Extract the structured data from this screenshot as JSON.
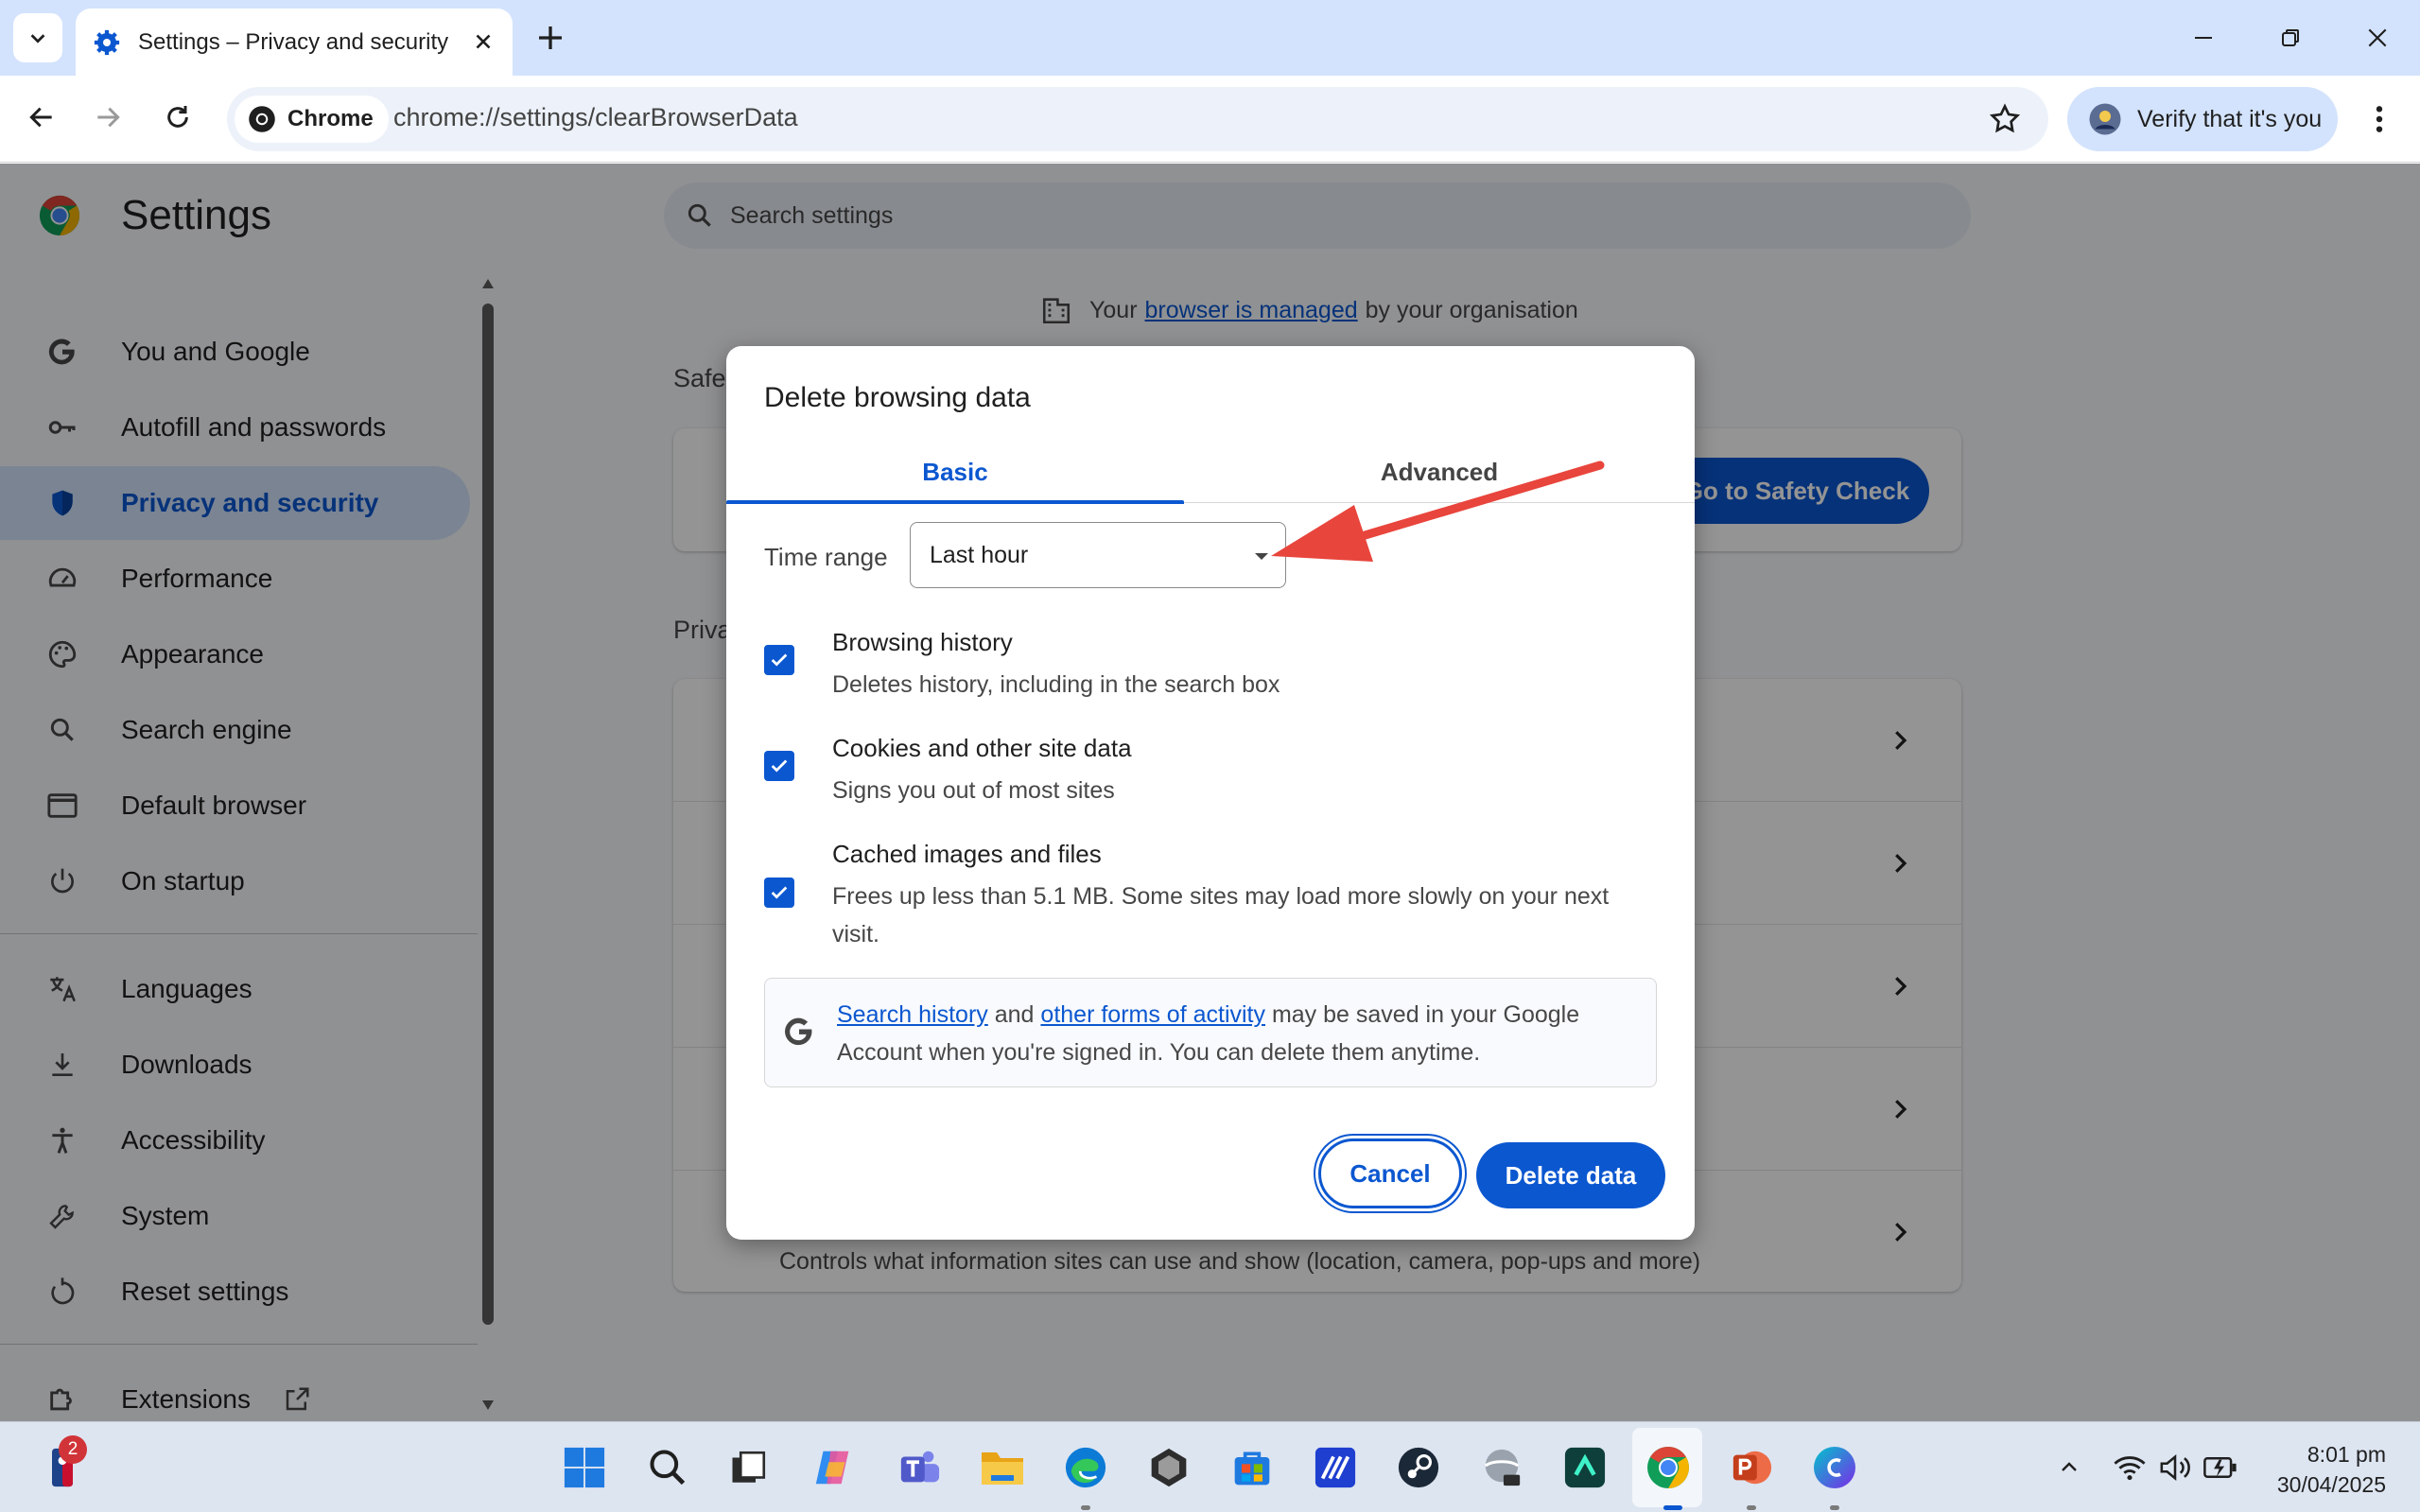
{
  "browser": {
    "tab_title": "Settings – Privacy and security",
    "chip_label": "Chrome",
    "url": "chrome://settings/clearBrowserData",
    "verify_label": "Verify that it's you"
  },
  "settings": {
    "title": "Settings",
    "search_placeholder": "Search settings",
    "managed_prefix": "Your",
    "managed_link": "browser is managed",
    "managed_suffix": "by your organisation",
    "section_safety": "Safe",
    "section_privacy": "Priva",
    "safety_button": "Go to Safety Check",
    "row_last_sub": "Controls what information sites can use and show (location, camera, pop-ups and more)",
    "nav": [
      {
        "label": "You and Google",
        "icon": "google-g-icon"
      },
      {
        "label": "Autofill and passwords",
        "icon": "key-icon"
      },
      {
        "label": "Privacy and security",
        "icon": "shield-icon",
        "active": true
      },
      {
        "label": "Performance",
        "icon": "speedometer-icon"
      },
      {
        "label": "Appearance",
        "icon": "palette-icon"
      },
      {
        "label": "Search engine",
        "icon": "search-icon"
      },
      {
        "label": "Default browser",
        "icon": "browser-window-icon"
      },
      {
        "label": "On startup",
        "icon": "power-icon"
      },
      {
        "label": "Languages",
        "icon": "translate-icon"
      },
      {
        "label": "Downloads",
        "icon": "download-icon"
      },
      {
        "label": "Accessibility",
        "icon": "accessibility-icon"
      },
      {
        "label": "System",
        "icon": "wrench-icon"
      },
      {
        "label": "Reset settings",
        "icon": "reset-icon"
      },
      {
        "label": "Extensions",
        "icon": "puzzle-icon"
      }
    ]
  },
  "dialog": {
    "title": "Delete browsing data",
    "tab_basic": "Basic",
    "tab_advanced": "Advanced",
    "time_range_label": "Time range",
    "time_range_value": "Last hour",
    "options": [
      {
        "title": "Browsing history",
        "desc": "Deletes history, including in the search box",
        "checked": true
      },
      {
        "title": "Cookies and other site data",
        "desc": "Signs you out of most sites",
        "checked": true
      },
      {
        "title": "Cached images and files",
        "desc": "Frees up less than 5.1 MB. Some sites may load more slowly on your next visit.",
        "checked": true
      }
    ],
    "info_link1": "Search history",
    "info_and": "and",
    "info_link2": "other forms of activity",
    "info_rest": "may be saved in your Google Account when you're signed in. You can delete them anytime.",
    "cancel_label": "Cancel",
    "delete_label": "Delete data"
  },
  "taskbar": {
    "badge_count": "2",
    "time": "8:01 pm",
    "date": "30/04/2025"
  },
  "colors": {
    "accent": "#0b57d0",
    "annotation_arrow": "#e8453c"
  }
}
